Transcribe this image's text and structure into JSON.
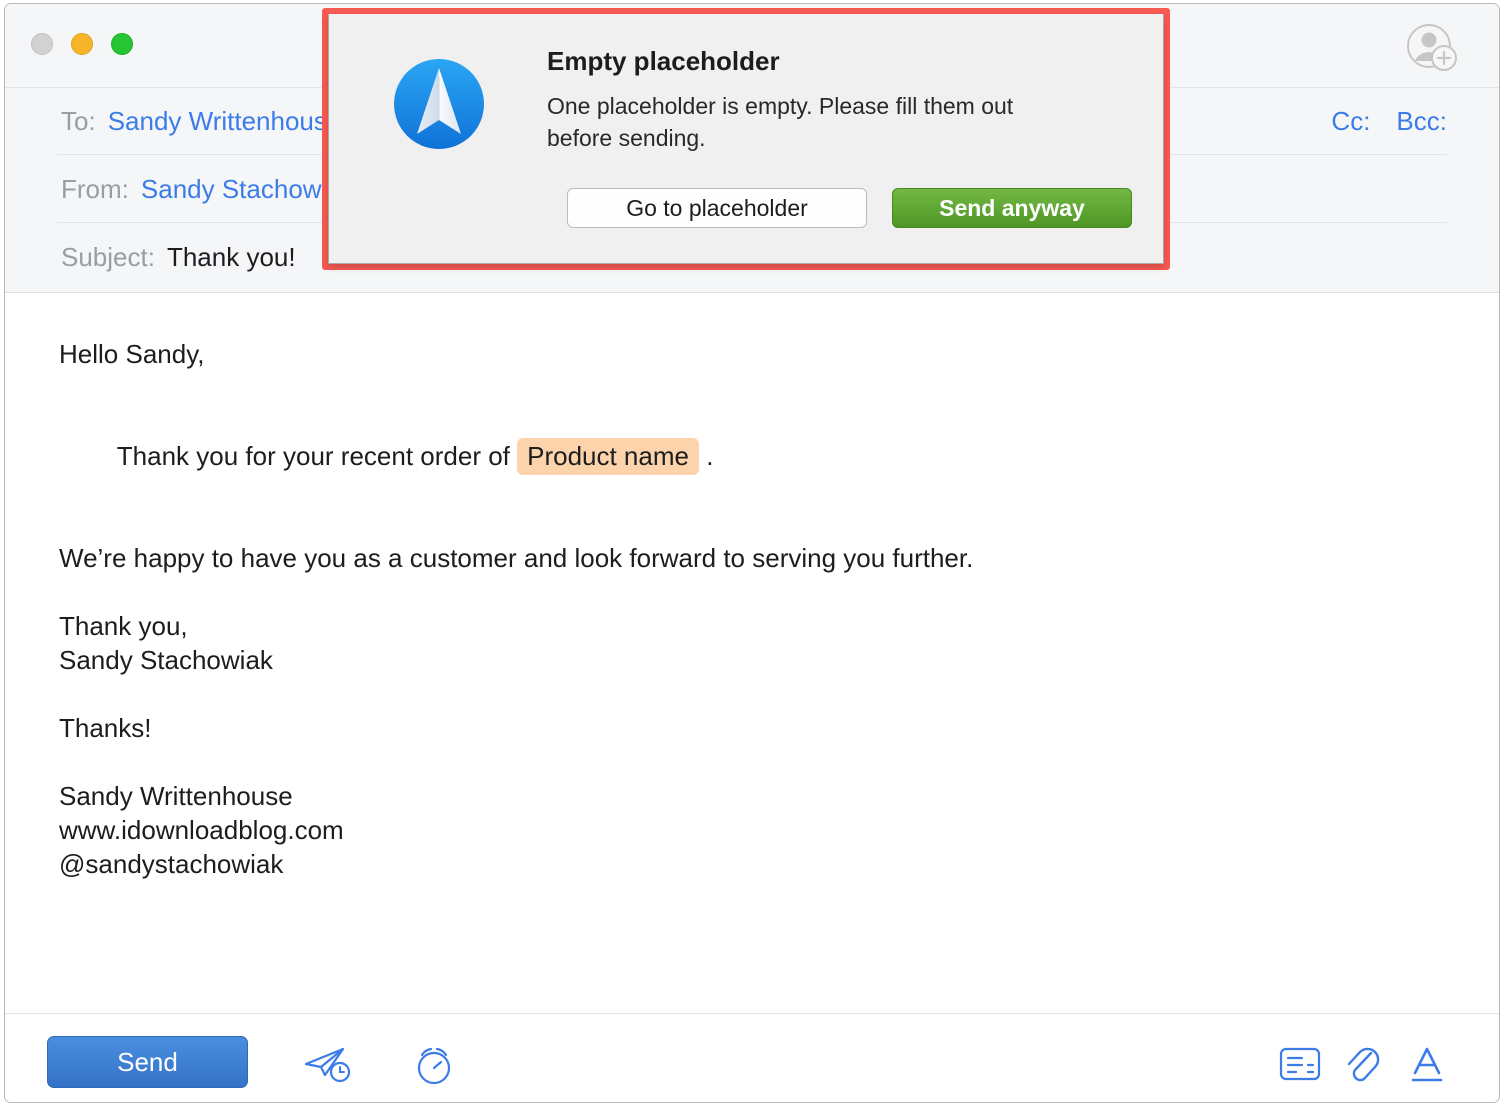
{
  "window": {
    "traffic_lights": [
      {
        "name": "close",
        "color": "#d2d2d2"
      },
      {
        "name": "minimize",
        "color": "#f7b529"
      },
      {
        "name": "maximize",
        "color": "#25c533"
      }
    ],
    "add_contact_icon": "add-contact-icon"
  },
  "compose": {
    "to": {
      "label": "To:",
      "value": "Sandy Writtenhouse"
    },
    "from": {
      "label": "From:",
      "value": "Sandy Stachowiak"
    },
    "subject": {
      "label": "Subject:",
      "value": "Thank you!"
    },
    "cc_label": "Cc:",
    "bcc_label": "Bcc:"
  },
  "body": {
    "greeting": "Hello Sandy,",
    "line_order_prefix": "Thank you for your recent order of ",
    "placeholder_text": "Product name",
    "line_order_suffix": " .",
    "line_happy": "We’re happy to have you as a customer and look forward to serving you further.",
    "closing": "Thank you,\nSandy Stachowiak",
    "thanks": "Thanks!",
    "signature": "Sandy Writtenhouse\nwww.idownloadblog.com\n@sandystachowiak",
    "placeholder_highlight_color": "#fdd3ab"
  },
  "toolbar": {
    "send_label": "Send",
    "send_color": "#3473c7",
    "icons": [
      {
        "name": "send-later-icon"
      },
      {
        "name": "reminder-icon"
      },
      {
        "name": "template-icon"
      },
      {
        "name": "attachment-icon"
      },
      {
        "name": "format-text-icon"
      }
    ]
  },
  "dialog": {
    "app_icon": "spark-app-icon",
    "title": "Empty placeholder",
    "message": "One placeholder is empty. Please fill them out before sending.",
    "secondary_button": "Go to placeholder",
    "primary_button": "Send anyway",
    "primary_color": "#5a9f2b",
    "annotation_color": "#f95a52"
  }
}
